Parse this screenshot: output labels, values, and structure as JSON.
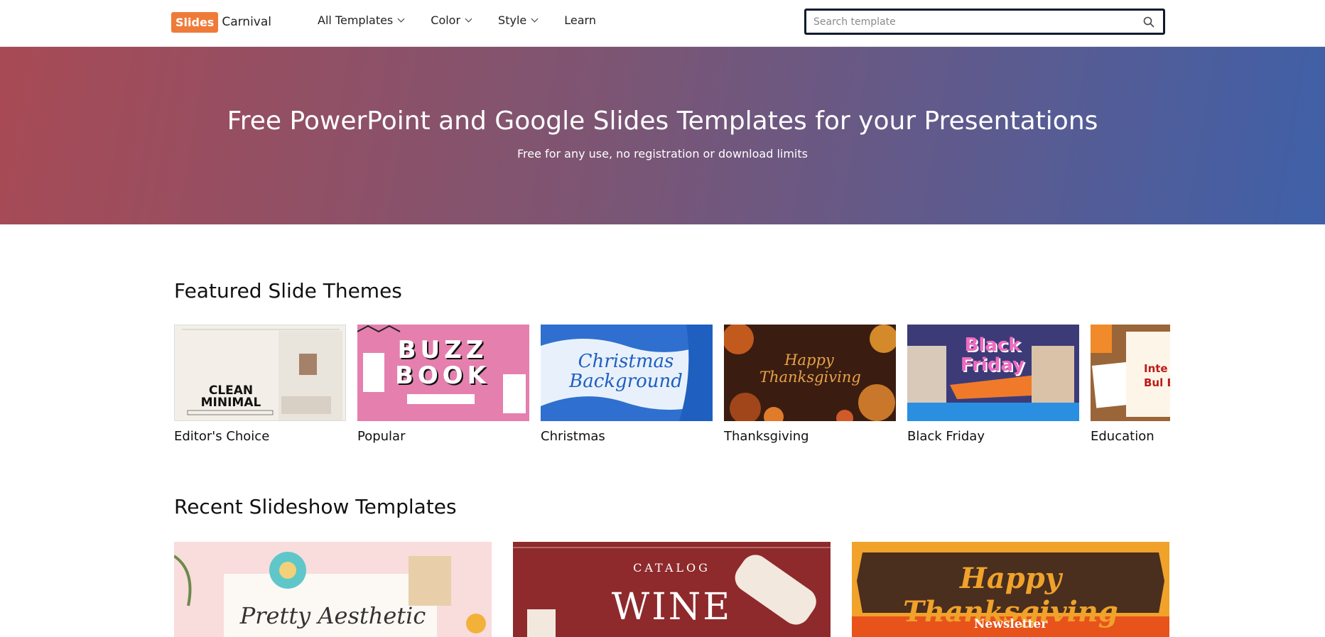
{
  "logo": {
    "badge": "Slides",
    "name": "Carnival"
  },
  "nav": [
    {
      "label": "All Templates",
      "dropdown": true
    },
    {
      "label": "Color",
      "dropdown": true
    },
    {
      "label": "Style",
      "dropdown": true
    },
    {
      "label": "Learn",
      "dropdown": false
    }
  ],
  "search": {
    "placeholder": "Search template",
    "value": ""
  },
  "hero": {
    "title": "Free PowerPoint and Google Slides Templates for your Presentations",
    "subtitle": "Free for any use, no registration or download limits"
  },
  "featured": {
    "title": "Featured Slide Themes",
    "items": [
      {
        "label": "Editor's Choice",
        "thumb_text": "CLEAN MINIMAL"
      },
      {
        "label": "Popular",
        "thumb_text": "BUZZ BOOK"
      },
      {
        "label": "Christmas",
        "thumb_text": "Christmas Background"
      },
      {
        "label": "Thanksgiving",
        "thumb_text": "Happy Thanksgiving"
      },
      {
        "label": "Black Friday",
        "thumb_text": "Black Friday"
      },
      {
        "label": "Education",
        "thumb_text": "Inte Bul Bo"
      }
    ]
  },
  "recent": {
    "title": "Recent Slideshow Templates",
    "items": [
      {
        "thumb_text": "Pretty Aesthetic"
      },
      {
        "thumb_text": "WINE",
        "thumb_subtext": "CATALOG"
      },
      {
        "thumb_text": "Happy Thanksgiving",
        "thumb_subtext": "Newsletter"
      }
    ]
  },
  "colors": {
    "brand": "#ef7b3a",
    "hero_start": "#a84a55",
    "hero_end": "#3f60a8"
  }
}
